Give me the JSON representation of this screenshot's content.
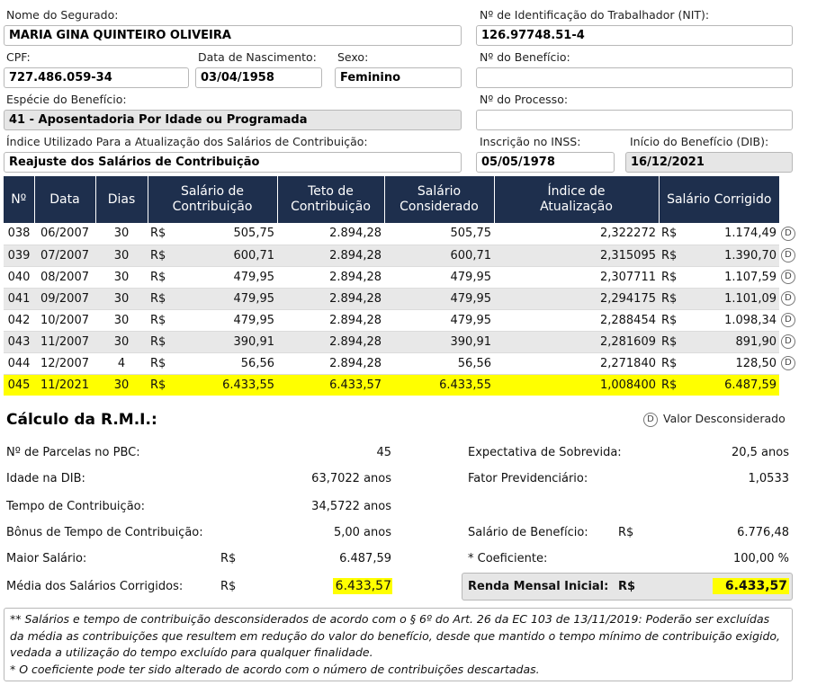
{
  "form": {
    "nome_label": "Nome do Segurado:",
    "nome_value": "MARIA GINA QUINTEIRO OLIVEIRA",
    "nit_label": "Nº de Identificação do Trabalhador (NIT):",
    "nit_value": "126.97748.51-4",
    "cpf_label": "CPF:",
    "cpf_value": "727.486.059-34",
    "nasc_label": "Data de Nascimento:",
    "nasc_value": "03/04/1958",
    "sexo_label": "Sexo:",
    "sexo_value": "Feminino",
    "beneficio_label": "Nº do Benefício:",
    "beneficio_value": "",
    "especie_label": "Espécie do Benefício:",
    "especie_value": "41 - Aposentadoria Por Idade ou Programada",
    "processo_label": "Nº do Processo:",
    "processo_value": "",
    "indice_label": "Índice Utilizado Para a Atualização dos Salários de Contribuição:",
    "indice_value": "Reajuste dos Salários de Contribuição",
    "inscricao_label": "Inscrição no INSS:",
    "inscricao_value": "05/05/1978",
    "dib_label": "Início do Benefício (DIB):",
    "dib_value": "16/12/2021"
  },
  "table": {
    "headers": {
      "n": "Nº",
      "data": "Data",
      "dias": "Dias",
      "salario_1": "Salário de",
      "salario_2": "Contribuição",
      "teto_1": "Teto de",
      "teto_2": "Contribuição",
      "considerado_1": "Salário",
      "considerado_2": "Considerado",
      "indice_1": "Índice de",
      "indice_2": "Atualização",
      "corrigido": "Salário Corrigido"
    },
    "currency": "R$",
    "rows": [
      {
        "n": "038",
        "data": "06/2007",
        "dias": "30",
        "salario": "505,75",
        "teto": "2.894,28",
        "considerado": "505,75",
        "indice": "2,322272",
        "corrigido": "1.174,49",
        "flag": "D"
      },
      {
        "n": "039",
        "data": "07/2007",
        "dias": "30",
        "salario": "600,71",
        "teto": "2.894,28",
        "considerado": "600,71",
        "indice": "2,315095",
        "corrigido": "1.390,70",
        "flag": "D"
      },
      {
        "n": "040",
        "data": "08/2007",
        "dias": "30",
        "salario": "479,95",
        "teto": "2.894,28",
        "considerado": "479,95",
        "indice": "2,307711",
        "corrigido": "1.107,59",
        "flag": "D"
      },
      {
        "n": "041",
        "data": "09/2007",
        "dias": "30",
        "salario": "479,95",
        "teto": "2.894,28",
        "considerado": "479,95",
        "indice": "2,294175",
        "corrigido": "1.101,09",
        "flag": "D"
      },
      {
        "n": "042",
        "data": "10/2007",
        "dias": "30",
        "salario": "479,95",
        "teto": "2.894,28",
        "considerado": "479,95",
        "indice": "2,288454",
        "corrigido": "1.098,34",
        "flag": "D"
      },
      {
        "n": "043",
        "data": "11/2007",
        "dias": "30",
        "salario": "390,91",
        "teto": "2.894,28",
        "considerado": "390,91",
        "indice": "2,281609",
        "corrigido": "891,90",
        "flag": "D"
      },
      {
        "n": "044",
        "data": "12/2007",
        "dias": "4",
        "salario": "56,56",
        "teto": "2.894,28",
        "considerado": "56,56",
        "indice": "2,271840",
        "corrigido": "128,50",
        "flag": "D"
      },
      {
        "n": "045",
        "data": "11/2021",
        "dias": "30",
        "salario": "6.433,55",
        "teto": "6.433,57",
        "considerado": "6.433,55",
        "indice": "1,008400",
        "corrigido": "6.487,59",
        "flag": ""
      }
    ]
  },
  "rmi": {
    "title": "Cálculo da R.M.I.:",
    "legend_icon": "D",
    "legend_text": "Valor Desconsiderado",
    "currency": "R$",
    "parcelas_label": "Nº de Parcelas no PBC:",
    "parcelas_value": "45",
    "idade_label": "Idade na DIB:",
    "idade_value": "63,7022 anos",
    "tempo_label": "Tempo de Contribuição:",
    "tempo_value": "34,5722 anos",
    "bonus_label": "Bônus de Tempo de Contribuição:",
    "bonus_value": "5,00 anos",
    "maior_label": "Maior Salário:",
    "maior_value": "6.487,59",
    "media_label": "Média dos Salários Corrigidos:",
    "media_value": "6.433,57",
    "expectativa_label": "Expectativa de Sobrevida:",
    "expectativa_value": "20,5 anos",
    "fator_label": "Fator Previdenciário:",
    "fator_value": "1,0533",
    "salario_beneficio_label": "Salário de Benefício:",
    "salario_beneficio_value": "6.776,48",
    "coeficiente_label": "* Coeficiente:",
    "coeficiente_value": "100,00 %",
    "renda_label": "Renda Mensal Inicial:",
    "renda_value": "6.433,57"
  },
  "notes": {
    "line1": "** Salários e tempo de contribuição desconsiderados de acordo com o § 6º do Art. 26 da EC 103 de 13/11/2019: Poderão ser excluídas da média as contribuições que resultem em redução do valor do benefício, desde que mantido o tempo mínimo de contribuição exigido, vedada a utilização do tempo excluído para qualquer finalidade.",
    "line2": "* O coeficiente pode ter sido alterado de acordo com o número de contribuições descartadas."
  },
  "colors": {
    "header_bg": "#1e2f4d",
    "highlight": "#ffff00",
    "alt_row": "#e8e8e8",
    "gray_field": "#e6e6e6"
  }
}
